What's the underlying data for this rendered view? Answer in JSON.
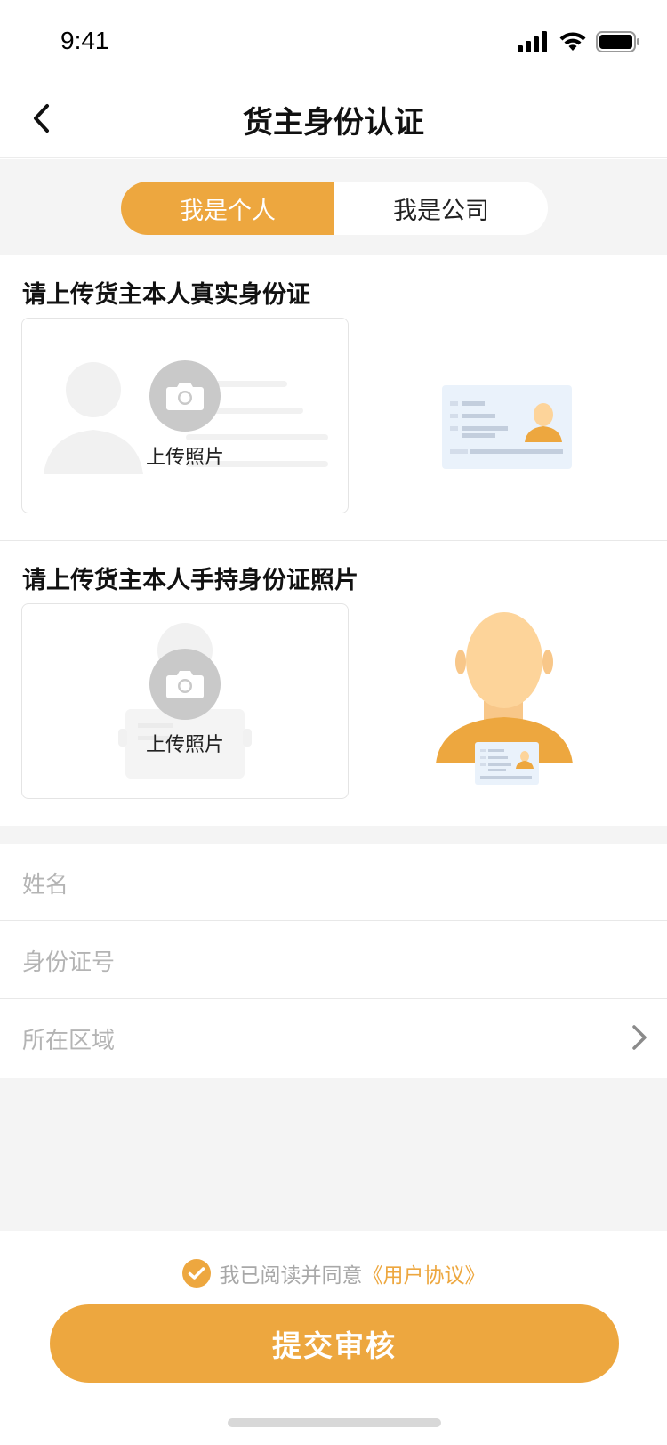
{
  "status_bar": {
    "time": "9:41"
  },
  "nav": {
    "title": "货主身份认证"
  },
  "tabs": [
    {
      "label": "我是个人",
      "selected": true
    },
    {
      "label": "我是公司",
      "selected": false
    }
  ],
  "id_card_section": {
    "title": "请上传货主本人真实身份证",
    "upload_label": "上传照片"
  },
  "handheld_section": {
    "title": "请上传货主本人手持身份证照片",
    "upload_label": "上传照片"
  },
  "form": {
    "name_placeholder": "姓名",
    "id_number_placeholder": "身份证号",
    "region_placeholder": "所在区域"
  },
  "agreement": {
    "checked": true,
    "text": "我已阅读并同意",
    "link": "《用户协议》"
  },
  "submit_label": "提交审核",
  "colors": {
    "accent": "#EDA73F",
    "page_bg": "#F4F4F4"
  },
  "icons": [
    "back-arrow-icon",
    "signal-icon",
    "wifi-icon",
    "battery-icon",
    "camera-icon",
    "chevron-right-icon",
    "check-icon"
  ]
}
